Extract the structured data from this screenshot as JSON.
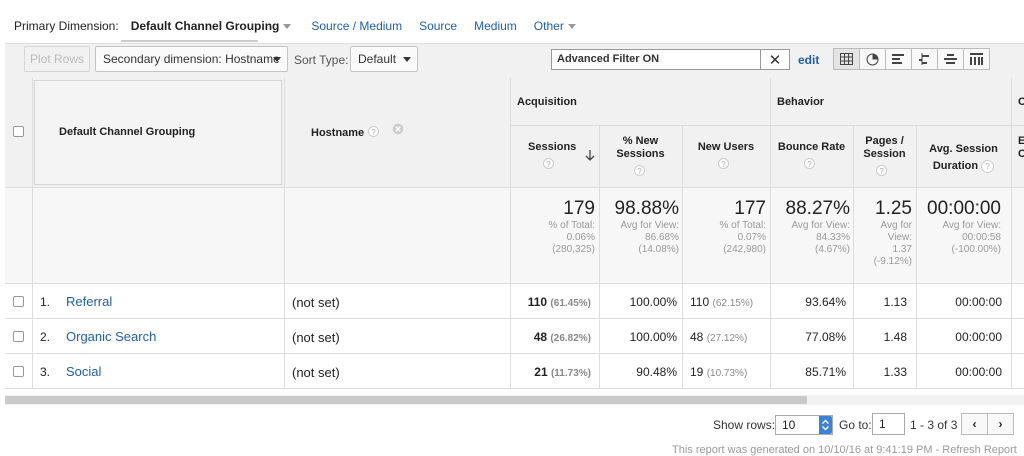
{
  "dimension_bar": {
    "label": "Primary Dimension:",
    "selected": "Default Channel Grouping",
    "links": [
      "Source / Medium",
      "Source",
      "Medium"
    ],
    "other": "Other"
  },
  "toolbar": {
    "plot_rows": "Plot Rows",
    "secondary_dimension": "Secondary dimension: Hostname",
    "sort_type_label": "Sort Type:",
    "sort_type_value": "Default",
    "filter_value": "Advanced Filter ON",
    "edit": "edit"
  },
  "table": {
    "col_channel": "Default Channel Grouping",
    "col_hostname": "Hostname",
    "group_acquisition": "Acquisition",
    "group_behavior": "Behavior",
    "group_conversions_cut": "C",
    "col_sessions": "Sessions",
    "col_new_sessions_1": "% New",
    "col_new_sessions_2": "Sessions",
    "col_new_users": "New Users",
    "col_bounce": "Bounce Rate",
    "col_pages_1": "Pages /",
    "col_pages_2": "Session",
    "col_duration_1": "Avg. Session",
    "col_duration_2": "Duration",
    "col_cut_1": "E",
    "col_cut_2": "C",
    "totals": {
      "sessions": {
        "value": "179",
        "l1": "% of Total:",
        "l2": "0.06%",
        "l3": "(280,325)"
      },
      "new_sessions": {
        "value": "98.88%",
        "l1": "Avg for View:",
        "l2": "86.68%",
        "l3": "(14.08%)"
      },
      "new_users": {
        "value": "177",
        "l1": "% of Total:",
        "l2": "0.07%",
        "l3": "(242,980)"
      },
      "bounce": {
        "value": "88.27%",
        "l1": "Avg for View:",
        "l2": "84.33%",
        "l3": "(4.67%)"
      },
      "pages": {
        "value": "1.25",
        "l1": "Avg for",
        "l2": "View:",
        "l3": "1.37",
        "l4": "(-9.12%)"
      },
      "duration": {
        "value": "00:00:00",
        "l1": "Avg for View:",
        "l2": "00:00:58",
        "l3": "(-100.00%)"
      }
    },
    "rows": [
      {
        "idx": "1.",
        "channel": "Referral",
        "hostname": "(not set)",
        "sessions": "110",
        "sessions_pct": "(61.45%)",
        "new_sessions": "100.00%",
        "new_users": "110",
        "new_users_pct": "(62.15%)",
        "bounce": "93.64%",
        "pages": "1.13",
        "duration": "00:00:00"
      },
      {
        "idx": "2.",
        "channel": "Organic Search",
        "hostname": "(not set)",
        "sessions": "48",
        "sessions_pct": "(26.82%)",
        "new_sessions": "100.00%",
        "new_users": "48",
        "new_users_pct": "(27.12%)",
        "bounce": "77.08%",
        "pages": "1.48",
        "duration": "00:00:00"
      },
      {
        "idx": "3.",
        "channel": "Social",
        "hostname": "(not set)",
        "sessions": "21",
        "sessions_pct": "(11.73%)",
        "new_sessions": "90.48%",
        "new_users": "19",
        "new_users_pct": "(10.73%)",
        "bounce": "85.71%",
        "pages": "1.33",
        "duration": "00:00:00"
      }
    ]
  },
  "footer": {
    "show_rows_label": "Show rows:",
    "show_rows_value": "10",
    "goto_label": "Go to:",
    "goto_value": "1",
    "range": "1 - 3 of 3",
    "prev": "‹",
    "next": "›",
    "cut_text": "This report was generated on 10/10/16 at 9:41:19 PM - Refresh Report"
  },
  "icons": [
    "caret-down-icon",
    "close-icon",
    "table-view-icon",
    "pie-view-icon",
    "bar-view-icon",
    "compare-view-icon",
    "term-cloud-view-icon",
    "pivot-view-icon",
    "help-icon",
    "remove-dimension-icon",
    "sort-desc-icon"
  ]
}
